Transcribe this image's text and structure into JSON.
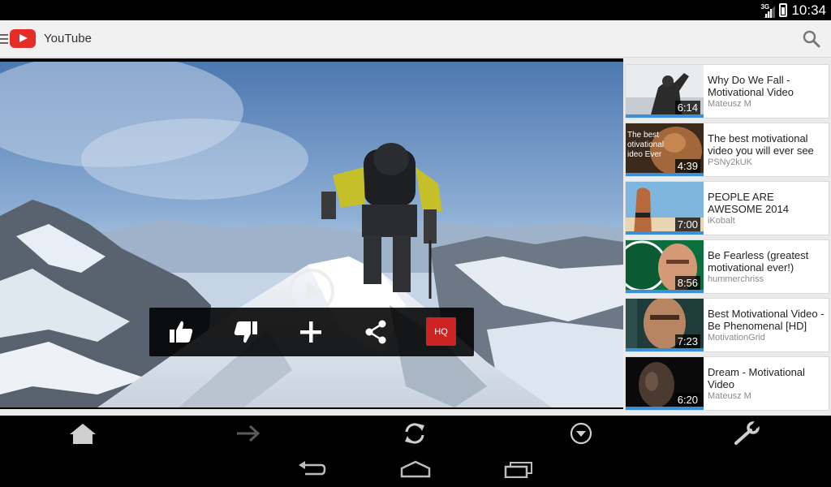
{
  "status": {
    "time": "10:34",
    "network": "3G",
    "icons": [
      "signal-icon",
      "battery-icon"
    ]
  },
  "app": {
    "title": "YouTube",
    "icons": [
      "menu-icon",
      "youtube-logo",
      "search-icon"
    ]
  },
  "player": {
    "icons": [
      "play-icon",
      "like-icon",
      "dislike-icon",
      "add-icon",
      "share-icon"
    ],
    "hq_label": "HQ"
  },
  "videos": [
    {
      "title": "Why Do We Fall - Motivational Video",
      "channel": "Mateusz M",
      "duration": "6:14"
    },
    {
      "title": "The best motivational video you will ever see",
      "channel": "PSNy2kUK",
      "duration": "4:39",
      "thumb_text": [
        "The best",
        "otivational",
        "ideo Ever"
      ]
    },
    {
      "title": "PEOPLE ARE AWESOME 2014",
      "channel": "iKobalt",
      "duration": "7:00"
    },
    {
      "title": "Be Fearless (greatest motivational ever!)",
      "channel": "hummerchriss",
      "duration": "8:56"
    },
    {
      "title": "Best Motivational Video - Be Phenomenal [HD]",
      "channel": "MotivationGrid",
      "duration": "7:23"
    },
    {
      "title": "Dream - Motivational Video",
      "channel": "Mateusz M",
      "duration": "6:20"
    }
  ],
  "browser_bar": {
    "icons": [
      "home-icon",
      "forward-icon",
      "refresh-icon",
      "dropdown-icon",
      "settings-wrench-icon"
    ]
  },
  "nav_bar": {
    "icons": [
      "back-icon",
      "home-nav-icon",
      "recent-apps-icon"
    ]
  },
  "colors": {
    "accent": "#e52d27",
    "progress": "#3b8fd9",
    "hq": "#cc2424"
  }
}
